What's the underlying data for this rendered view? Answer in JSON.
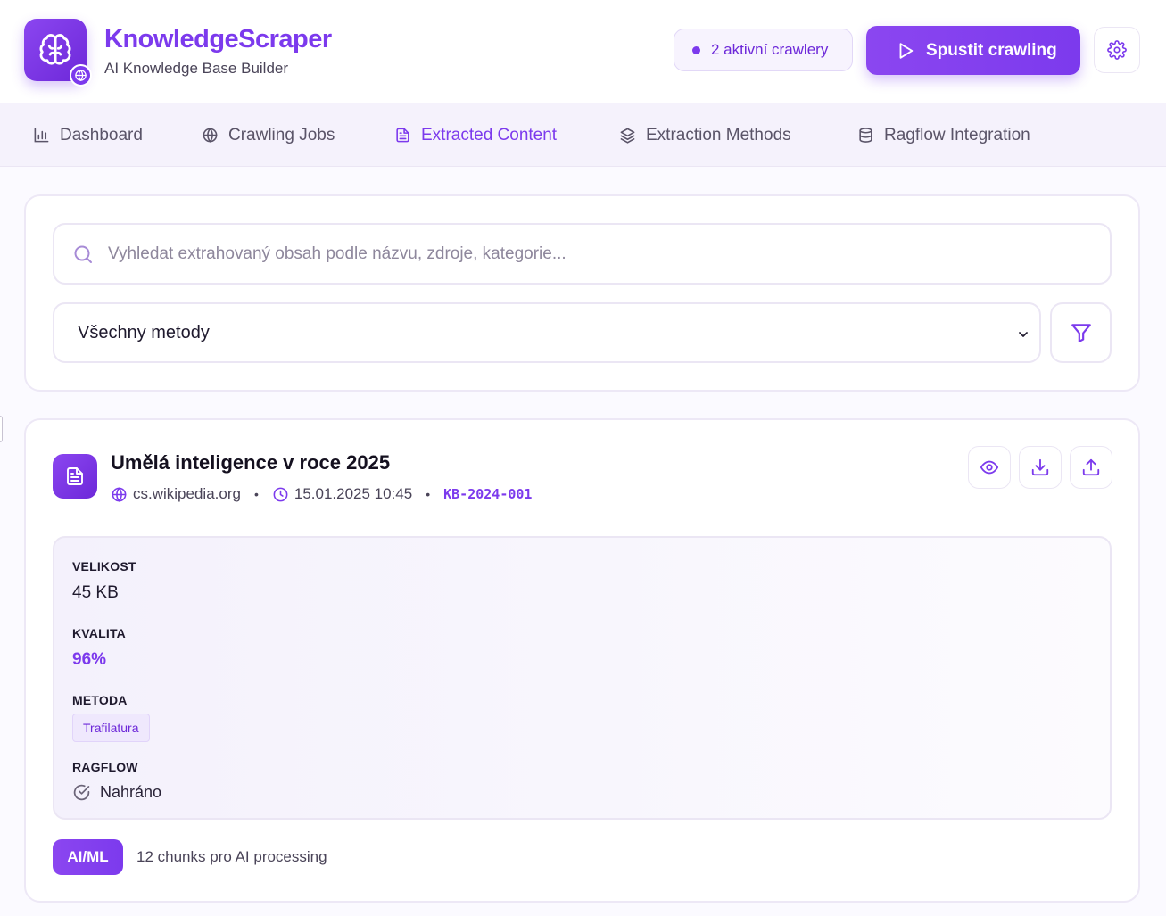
{
  "app": {
    "title": "KnowledgeScraper",
    "subtitle": "AI Knowledge Base Builder",
    "active_crawlers": "2 aktivní crawlery",
    "start_button": "Spustit crawling",
    "accent_color": "#7c3aed"
  },
  "tabs": [
    {
      "label": "Dashboard",
      "icon": "bar-chart-icon",
      "active": false
    },
    {
      "label": "Crawling Jobs",
      "icon": "globe-icon",
      "active": false
    },
    {
      "label": "Extracted Content",
      "icon": "document-icon",
      "active": true
    },
    {
      "label": "Extraction Methods",
      "icon": "layers-icon",
      "active": false
    },
    {
      "label": "Ragflow Integration",
      "icon": "database-icon",
      "active": false
    }
  ],
  "filters": {
    "search_placeholder": "Vyhledat extrahovaný obsah podle názvu, zdroje, kategorie...",
    "method_select": "Všechny metody"
  },
  "item": {
    "title": "Umělá inteligence v roce 2025",
    "source": "cs.wikipedia.org",
    "date": "15.01.2025 10:45",
    "id": "KB-2024-001",
    "size_label": "VELIKOST",
    "size_value": "45 KB",
    "quality_label": "KVALITA",
    "quality_value": "96%",
    "method_label": "METODA",
    "method_value": "Trafilatura",
    "ragflow_label": "RAGFLOW",
    "ragflow_value": "Nahráno",
    "category_badge": "AI/ML",
    "chunks_text": "12 chunks pro AI processing"
  }
}
